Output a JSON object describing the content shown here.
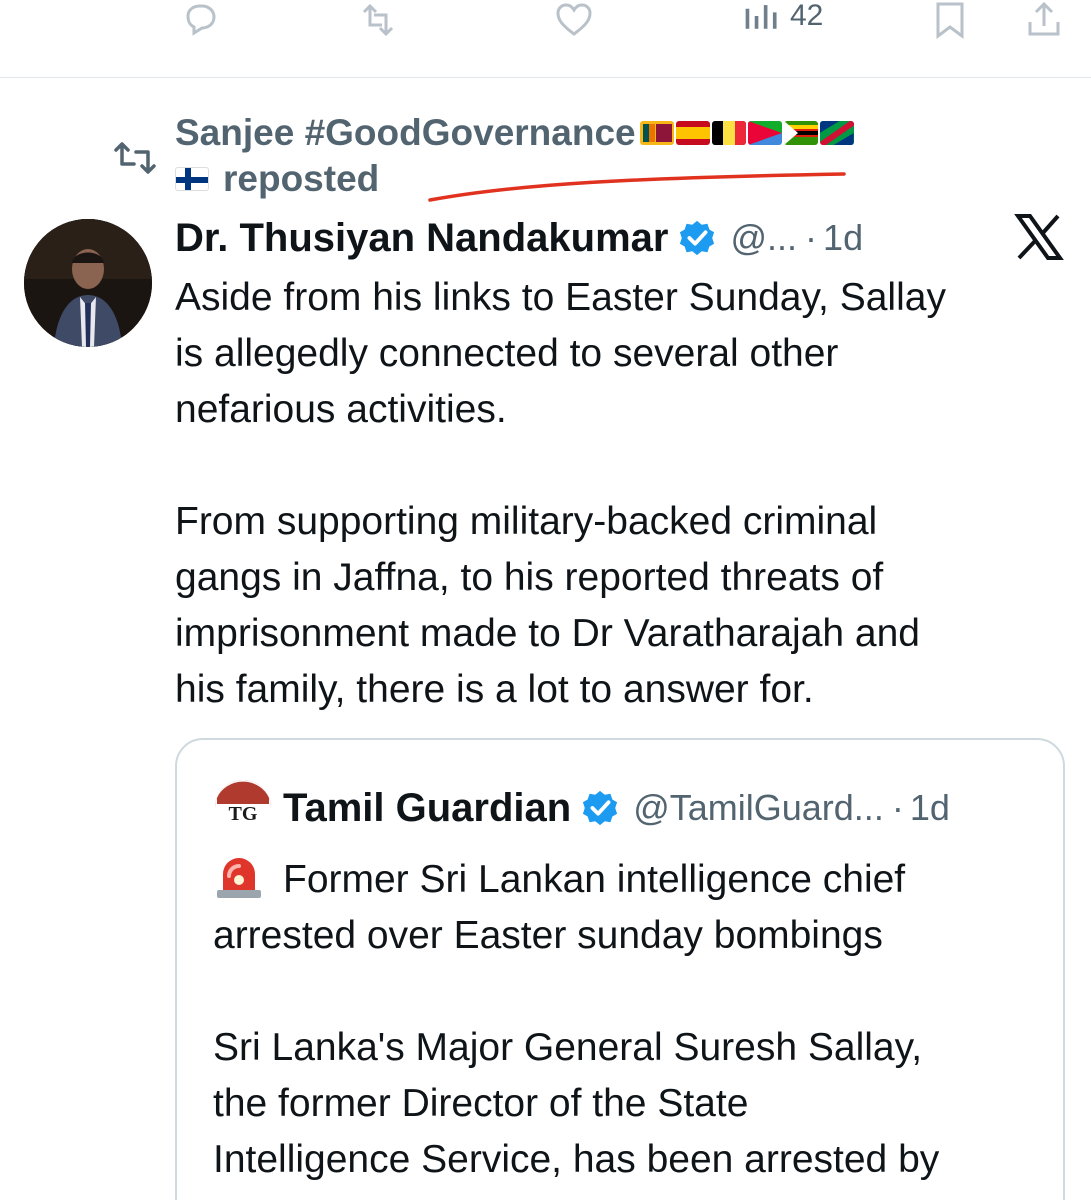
{
  "top_actions": {
    "views_count": "42",
    "icons": [
      "reply-icon",
      "repost-icon",
      "like-icon",
      "views-icon",
      "bookmark-icon",
      "share-icon"
    ]
  },
  "repost": {
    "user": "Sanjee #GoodGovernance",
    "suffix": "reposted",
    "flags": [
      "sri-lanka-flag",
      "spain-flag",
      "belgium-flag",
      "eritrea-flag",
      "zimbabwe-flag",
      "namibia-flag",
      "finland-flag"
    ]
  },
  "tweet": {
    "author_name": "Dr. Thusiyan Nandakumar",
    "handle": "@...",
    "separator": "·",
    "time": "1d",
    "text_lines": [
      "Aside from his links to Easter Sunday, Sallay",
      "is allegedly connected to several other",
      "nefarious activities."
    ],
    "text_lines_2": [
      "From supporting military-backed criminal",
      "gangs in Jaffna, to his reported threats of",
      "imprisonment made to Dr Varatharajah and",
      "his family, there is a lot to answer for."
    ]
  },
  "quote": {
    "avatar_text": "TG",
    "author_name": "Tamil Guardian",
    "handle": "@TamilGuard...",
    "separator": "·",
    "time": "1d",
    "headline_1": "Former Sri Lankan intelligence chief",
    "headline_2": "arrested over Easter sunday bombings",
    "body_lines": [
      "Sri Lanka's Major General Suresh Sallay,",
      "the former Director of the State",
      "Intelligence Service, has been arrested by"
    ]
  },
  "colors": {
    "text": "#0f1419",
    "secondary": "#536471",
    "verified": "#1d9bf0",
    "annotation": "#e0321e",
    "border": "#cfd9de"
  }
}
